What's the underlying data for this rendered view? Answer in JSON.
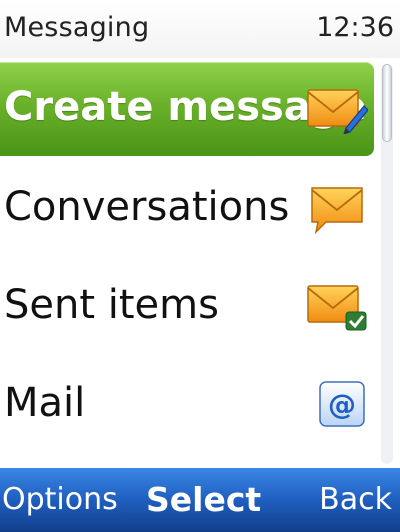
{
  "status_bar": {
    "title": "Messaging",
    "time": "12:36"
  },
  "menu": {
    "items": [
      {
        "label": "Create message",
        "icon": "envelope-pencil-icon",
        "selected": true
      },
      {
        "label": "Conversations",
        "icon": "envelope-speech-icon",
        "selected": false
      },
      {
        "label": "Sent items",
        "icon": "envelope-check-icon",
        "selected": false
      },
      {
        "label": "Mail",
        "icon": "at-sign-icon",
        "selected": false
      }
    ]
  },
  "softkeys": {
    "left": "Options",
    "center": "Select",
    "right": "Back"
  },
  "colors": {
    "selection": "#6ab22a",
    "softkey_bar": "#1f5fbf",
    "envelope": "#f5a623"
  }
}
